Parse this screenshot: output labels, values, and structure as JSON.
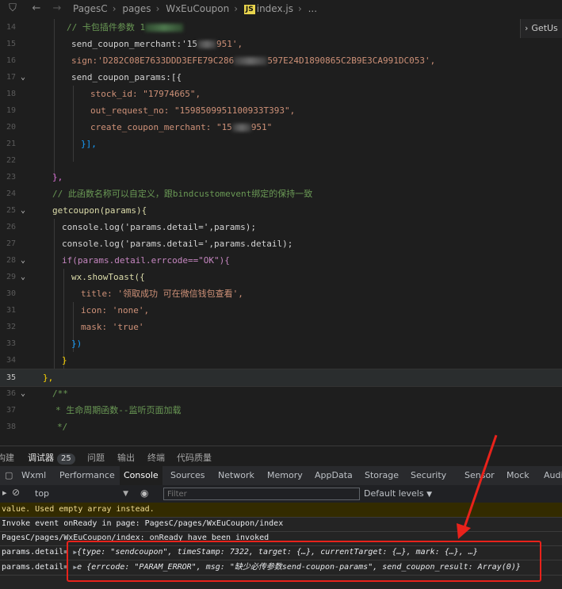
{
  "topbar": {
    "crumbs": [
      "PagesC",
      "pages",
      "WxEuCoupon"
    ],
    "file": "index.js",
    "ellipsis": "...",
    "js_badge": "JS",
    "getus": "GetUs"
  },
  "editor": {
    "lines": [
      {
        "n": "14",
        "t": "// 卡包插件参数 1"
      },
      {
        "n": "15",
        "t": "send_coupon_merchant:'15"
      },
      {
        "n": "16",
        "t": "sign:'D282C08E7633DDD3EFE79C286"
      },
      {
        "n": "17",
        "t": "send_coupon_params:[{"
      },
      {
        "n": "18",
        "t": "stock_id: \"17974665\","
      },
      {
        "n": "19",
        "t": "out_request_no: \"1598509951100933T393\","
      },
      {
        "n": "20",
        "t": "create_coupon_merchant: \"15"
      },
      {
        "n": "21",
        "t": "}],"
      },
      {
        "n": "22",
        "t": ""
      },
      {
        "n": "23",
        "t": "},"
      },
      {
        "n": "24",
        "t": "// 此函数名称可以自定义，跟bindcustomevent绑定的保持一致"
      },
      {
        "n": "25",
        "t": "getcoupon(params){"
      },
      {
        "n": "26",
        "t": "console.log('params.detail=',params);"
      },
      {
        "n": "27",
        "t": "console.log('params.detail=',params.detail);"
      },
      {
        "n": "28",
        "t": "if(params.detail.errcode==\"OK\"){"
      },
      {
        "n": "29",
        "t": "wx.showToast({"
      },
      {
        "n": "30",
        "t": "title: '领取成功 可在微信钱包查看',"
      },
      {
        "n": "31",
        "t": "icon: 'none',"
      },
      {
        "n": "32",
        "t": "mask: 'true'"
      },
      {
        "n": "33",
        "t": "})"
      },
      {
        "n": "34",
        "t": "}"
      },
      {
        "n": "35",
        "t": "},"
      },
      {
        "n": "36",
        "t": "/**"
      },
      {
        "n": "37",
        "t": "* 生命周期函数--监听页面加载"
      },
      {
        "n": "38",
        "t": "*/"
      }
    ],
    "frag": {
      "merchant_end": "951',",
      "sign_end": "597E24D1890865C2B9E3CA991DC053',",
      "create_end": "951\""
    }
  },
  "panel_tabs": [
    "构建",
    "调试器",
    "问题",
    "输出",
    "终端",
    "代码质量"
  ],
  "panel_badge": "25",
  "dev_tabs": [
    "Wxml",
    "Performance",
    "Console",
    "Sources",
    "Network",
    "Memory",
    "AppData",
    "Storage",
    "Security",
    "Sensor",
    "Mock",
    "Audi"
  ],
  "filter": {
    "context": "top",
    "placeholder": "Filter",
    "levels": "Default levels"
  },
  "console": {
    "warn": "value. Used empty array instead.",
    "line1": "Invoke event onReady in page: PagesC/pages/WxEuCoupon/index",
    "line2": "PagesC/pages/WxEuCoupon/index: onReady have been invoked",
    "log1_prefix": "params.detail=",
    "log1_body": "{type: \"sendcoupon\", timeStamp: 7322, target: {…}, currentTarget: {…}, mark: {…}, …}",
    "log2_prefix": "params.detail=",
    "log2_body": "e {errcode: \"PARAM_ERROR\", msg: \"缺少必传参数send-coupon-params\", send_coupon_result: Array(0)}"
  },
  "colors": {
    "annotation": "#e8221b",
    "accent": "#ffd700"
  }
}
